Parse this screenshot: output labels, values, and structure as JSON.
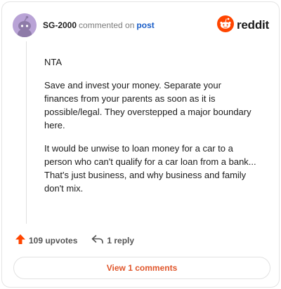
{
  "comment": {
    "username": "SG-2000",
    "action": "commented on",
    "target": "post",
    "avatar_icon": "snoo-avatar-icon",
    "paragraphs": [
      "NTA",
      "Save and invest your money. Separate your finances from your parents as soon as it is possible/legal. They overstepped a major boundary here.",
      "It would be unwise to loan money for a car to a person who can't qualify for a car loan from a bank... That's just business, and why business and family don't mix."
    ]
  },
  "brand": {
    "name": "reddit",
    "icon": "reddit-logo-icon",
    "color": "#ff4500"
  },
  "actions": {
    "upvotes_label": "109 upvotes",
    "upvote_icon": "upvote-arrow-icon",
    "upvote_color": "#ff4500",
    "reply_label": "1 reply",
    "reply_icon": "reply-arrow-icon"
  },
  "footer": {
    "view_comments_label": "View 1 comments",
    "accent": "#e0562b"
  }
}
